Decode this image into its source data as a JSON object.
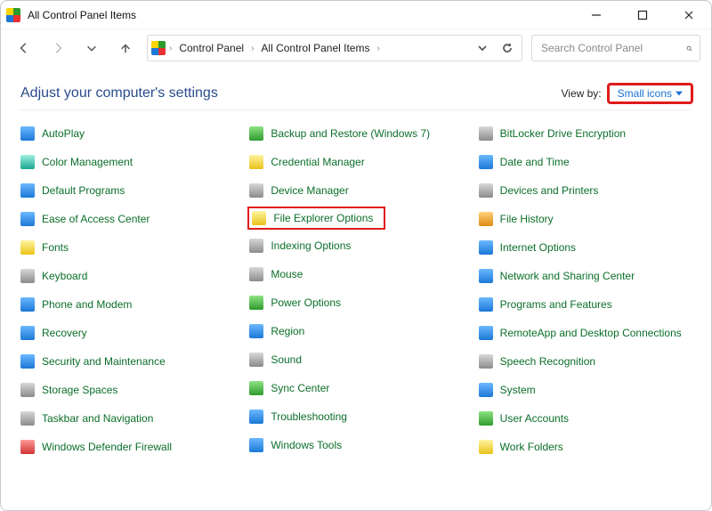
{
  "window": {
    "title": "All Control Panel Items"
  },
  "breadcrumb": {
    "root": "Control Panel",
    "current": "All Control Panel Items"
  },
  "search": {
    "placeholder": "Search Control Panel"
  },
  "heading": "Adjust your computer's settings",
  "viewby": {
    "label": "View by:",
    "value": "Small icons"
  },
  "items": {
    "col1": [
      {
        "name": "AutoPlay",
        "icon": "i-blue"
      },
      {
        "name": "Color Management",
        "icon": "i-teal"
      },
      {
        "name": "Default Programs",
        "icon": "i-blue"
      },
      {
        "name": "Ease of Access Center",
        "icon": "i-blue"
      },
      {
        "name": "Fonts",
        "icon": "i-yellow"
      },
      {
        "name": "Keyboard",
        "icon": "i-gray"
      },
      {
        "name": "Phone and Modem",
        "icon": "i-blue"
      },
      {
        "name": "Recovery",
        "icon": "i-blue"
      },
      {
        "name": "Security and Maintenance",
        "icon": "i-blue"
      },
      {
        "name": "Storage Spaces",
        "icon": "i-gray"
      },
      {
        "name": "Taskbar and Navigation",
        "icon": "i-gray"
      },
      {
        "name": "Windows Defender Firewall",
        "icon": "i-red"
      }
    ],
    "col2": [
      {
        "name": "Backup and Restore (Windows 7)",
        "icon": "i-green"
      },
      {
        "name": "Credential Manager",
        "icon": "i-yellow"
      },
      {
        "name": "Device Manager",
        "icon": "i-gray"
      },
      {
        "name": "File Explorer Options",
        "icon": "i-yellow",
        "highlight": true
      },
      {
        "name": "Indexing Options",
        "icon": "i-gray"
      },
      {
        "name": "Mouse",
        "icon": "i-gray"
      },
      {
        "name": "Power Options",
        "icon": "i-green"
      },
      {
        "name": "Region",
        "icon": "i-blue"
      },
      {
        "name": "Sound",
        "icon": "i-gray"
      },
      {
        "name": "Sync Center",
        "icon": "i-green"
      },
      {
        "name": "Troubleshooting",
        "icon": "i-blue"
      },
      {
        "name": "Windows Tools",
        "icon": "i-blue"
      }
    ],
    "col3": [
      {
        "name": "BitLocker Drive Encryption",
        "icon": "i-gray"
      },
      {
        "name": "Date and Time",
        "icon": "i-blue"
      },
      {
        "name": "Devices and Printers",
        "icon": "i-gray"
      },
      {
        "name": "File History",
        "icon": "i-orange"
      },
      {
        "name": "Internet Options",
        "icon": "i-blue"
      },
      {
        "name": "Network and Sharing Center",
        "icon": "i-blue"
      },
      {
        "name": "Programs and Features",
        "icon": "i-blue"
      },
      {
        "name": "RemoteApp and Desktop Connections",
        "icon": "i-blue"
      },
      {
        "name": "Speech Recognition",
        "icon": "i-gray"
      },
      {
        "name": "System",
        "icon": "i-blue"
      },
      {
        "name": "User Accounts",
        "icon": "i-green"
      },
      {
        "name": "Work Folders",
        "icon": "i-yellow"
      }
    ]
  }
}
